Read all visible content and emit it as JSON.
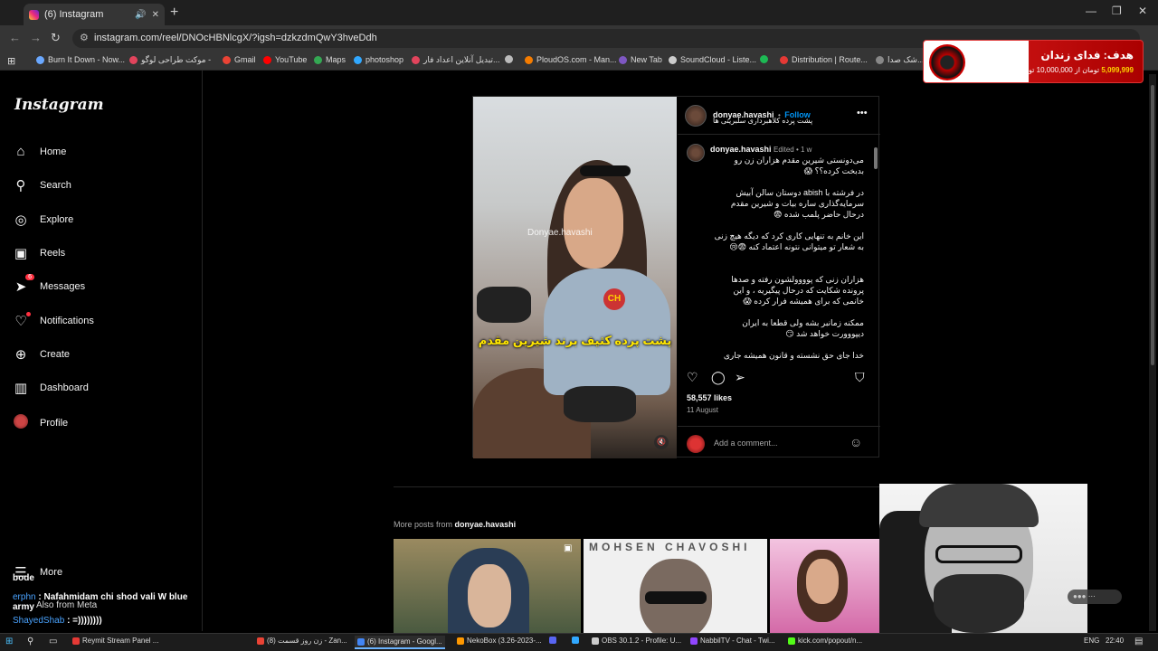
{
  "browser": {
    "tab_title": "(6) Instagram",
    "url": "instagram.com/reel/DNOcHBNlcgX/?igsh=dzkzdmQwY3hveDdh",
    "bookmarks": [
      {
        "label": "Burn It Down - Now...",
        "color": "#6aa8ff"
      },
      {
        "label": "موکت طراحی لوگو -",
        "color": "#e2445c"
      },
      {
        "label": "Gmail",
        "color": "#ea4335"
      },
      {
        "label": "YouTube",
        "color": "#ff0000"
      },
      {
        "label": "Maps",
        "color": "#34a853"
      },
      {
        "label": "photoshop",
        "color": "#31a8ff"
      },
      {
        "label": "تبدیل آنلاین اعداد فار...",
        "color": "#e2445c"
      },
      {
        "label": "",
        "color": "#bbbbbb"
      },
      {
        "label": "PloudOS.com - Man...",
        "color": "#f57c00"
      },
      {
        "label": "New Tab",
        "color": "#7e57c2"
      },
      {
        "label": "SoundCloud - Liste...",
        "color": "#cccccc"
      },
      {
        "label": "",
        "color": "#1db954"
      },
      {
        "label": "Distribution | Route...",
        "color": "#e53935"
      },
      {
        "label": "شک صدا...",
        "color": "#888888"
      }
    ]
  },
  "donation": {
    "title": "هدف: فدای زندان",
    "amount": "5,099,999",
    "rest": "تومان از 10,000,000 تومان تکمیل شده است."
  },
  "sidebar": {
    "logo": "Instagram",
    "items": [
      {
        "label": "Home",
        "icon": "⌂",
        "name": "home-icon"
      },
      {
        "label": "Search",
        "icon": "⚲",
        "name": "search-icon"
      },
      {
        "label": "Explore",
        "icon": "◎",
        "name": "compass-icon"
      },
      {
        "label": "Reels",
        "icon": "▣",
        "name": "reels-icon"
      },
      {
        "label": "Messages",
        "icon": "➤",
        "name": "messages-icon",
        "badge": "6"
      },
      {
        "label": "Notifications",
        "icon": "♡",
        "name": "heart-icon",
        "dot": true
      },
      {
        "label": "Create",
        "icon": "⊕",
        "name": "create-icon"
      },
      {
        "label": "Dashboard",
        "icon": "▥",
        "name": "dashboard-icon"
      },
      {
        "label": "Profile",
        "icon": "",
        "name": "profile-avatar"
      }
    ],
    "more": "More",
    "also_from": "Also from Meta"
  },
  "post": {
    "username": "donyae.havashi",
    "follow": "Follow",
    "subtitle": "پشت پرده کلاهبرداری سلبریتی ها",
    "video_watermark": "Donyae.havashi",
    "video_overlay": "پشت پرده کثیف برند شیرین مقدم",
    "video_logo": "CH",
    "caption_user": "donyae.havashi",
    "caption_meta": "Edited • 1 w",
    "caption": [
      "می‌دونستی شیرین مقدم هزاران زن رو بدبخت کرده؟؟ 😱",
      "در فرشته با abish دوستان سالن آبیش سرمایه‌گذاری ساره بیات و شیرین مقدم درحال حاضر پلمب شده 😨",
      "این خانم به تنهایی کاری کرد که دیگه هیچ زنی به شعار تو میتوانی نتونه اعتماد کنه 😨😢",
      "هزاران زنی که پوووولشون رفته و صدها پرونده شکایت که درحال پیگیریه ، و این خانمی که برای همیشه فرار کرده 😱",
      "ممکنه زمانبر بشه ولی قطعا به ایران دیپووورت خواهد شد 😏",
      "خدا جای حق نشسته و قانون همیشه جاری"
    ],
    "likes": "58,557 likes",
    "date": "11 August",
    "comment_placeholder": "Add a comment..."
  },
  "more_posts": {
    "prefix": "More posts from",
    "username": "donyae.havashi",
    "thumb_text": "MOHSEN CHAVOSHI"
  },
  "chat": {
    "line0": "bode",
    "user1": "erphn",
    "msg1": ": Nafahmidam chi shod vali W blue army",
    "user2": "ShayedShab",
    "msg2": ": =))))))))"
  },
  "taskbar": {
    "items": [
      {
        "label": "Reymit Stream Panel ...",
        "color": "#e53935"
      },
      {
        "label": "(8) زن روز قسمت - Zan...",
        "color": "#ea4335"
      },
      {
        "label": "(6) Instagram - Googl...",
        "color": "#4285f4",
        "active": true
      },
      {
        "label": "NekoBox (3.26-2023-...",
        "color": "#ff9800"
      },
      {
        "label": "",
        "color": "#5865f2"
      },
      {
        "label": "",
        "color": "#31a8ff"
      },
      {
        "label": "OBS 30.1.2 - Profile: U...",
        "color": "#cccccc"
      },
      {
        "label": "NabbilTV - Chat - Twi...",
        "color": "#9146ff"
      },
      {
        "label": "kick.com/popout/n...",
        "color": "#53fc18"
      }
    ],
    "lang": "ENG",
    "time": "22:40"
  }
}
